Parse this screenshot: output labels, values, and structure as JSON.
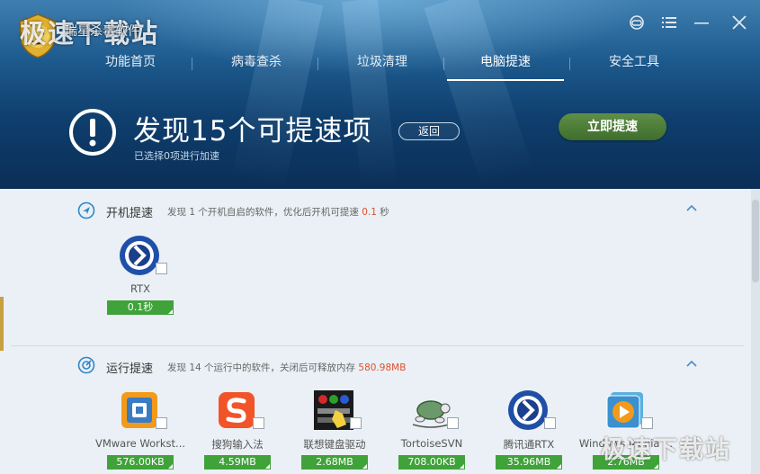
{
  "header": {
    "watermark_logo": "极速下载站",
    "product_name": "瑞星杀毒软件",
    "window_controls": [
      "user-icon",
      "menu-icon",
      "minimize-icon",
      "close-icon"
    ]
  },
  "nav": {
    "items": [
      {
        "label": "功能首页"
      },
      {
        "label": "病毒查杀"
      },
      {
        "label": "垃圾清理"
      },
      {
        "label": "电脑提速",
        "active": true
      },
      {
        "label": "安全工具"
      }
    ]
  },
  "summary": {
    "headline": "发现15个可提速项",
    "subline": "已选择0项进行加速",
    "back_label": "返回",
    "boost_label": "立即提速"
  },
  "startup": {
    "title": "开机提速",
    "desc_prefix": "发现 1 个开机自启的软件，优化后开机可提速",
    "desc_value": "0.1",
    "desc_suffix": "秒",
    "apps": [
      {
        "name": "RTX",
        "value": "0.1秒",
        "icon": "rtx-icon"
      }
    ]
  },
  "running": {
    "title": "运行提速",
    "desc_prefix": "发现 14 个运行中的软件，关闭后可释放内存",
    "desc_value": "580.98MB",
    "apps": [
      {
        "name": "VMware Workst...",
        "value": "576.00KB",
        "icon": "vmware-icon"
      },
      {
        "name": "搜狗输入法",
        "value": "4.59MB",
        "icon": "sogou-icon"
      },
      {
        "name": "联想键盘驱动",
        "value": "2.68MB",
        "icon": "lenovo-keyboard-icon"
      },
      {
        "name": "TortoiseSVN",
        "value": "708.00KB",
        "icon": "tortoisesvn-icon"
      },
      {
        "name": "腾讯通RTX",
        "value": "35.96MB",
        "icon": "rtx-icon"
      },
      {
        "name": "Windows Media ...",
        "value": "2.76MB",
        "icon": "windows-media-icon"
      }
    ]
  },
  "colors": {
    "accent_green": "#3fa339",
    "highlight_orange": "#e0502a",
    "header_dark": "#0a2e57",
    "boost_green": "#4f7f3a"
  }
}
